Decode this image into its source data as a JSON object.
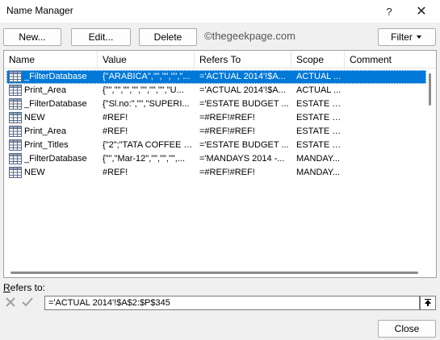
{
  "window": {
    "title": "Name Manager",
    "help": "?",
    "close": "✕"
  },
  "toolbar": {
    "new_label": "New...",
    "edit_label": "Edit...",
    "delete_label": "Delete",
    "filter_label": "Filter",
    "watermark": "©thegeekpage.com"
  },
  "columns": [
    "Name",
    "Value",
    "Refers To",
    "Scope",
    "Comment"
  ],
  "rows": [
    {
      "name": "_FilterDatabase",
      "value": "{\"ARABICA\",\"\",\"\",\"\",\"...",
      "refers_to": "='ACTUAL 2014'!$A...",
      "scope": "ACTUAL ...",
      "comment": "",
      "selected": true
    },
    {
      "name": "Print_Area",
      "value": "{\"\",\"\",\"\",\"\",\"\",\"\",\"\",\"U...",
      "refers_to": "='ACTUAL 2014'!$A...",
      "scope": "ACTUAL ...",
      "comment": "",
      "selected": false
    },
    {
      "name": "_FilterDatabase",
      "value": "{\"Sl.no:\",\"\",\"SUPERI...",
      "refers_to": "='ESTATE BUDGET ...",
      "scope": "ESTATE B...",
      "comment": "",
      "selected": false
    },
    {
      "name": "NEW",
      "value": "#REF!",
      "refers_to": "=#REF!#REF!",
      "scope": "ESTATE B...",
      "comment": "",
      "selected": false
    },
    {
      "name": "Print_Area",
      "value": "#REF!",
      "refers_to": "=#REF!#REF!",
      "scope": "ESTATE B...",
      "comment": "",
      "selected": false
    },
    {
      "name": "Print_Titles",
      "value": "{\"2\";\"TATA COFFEE L...",
      "refers_to": "='ESTATE BUDGET ...",
      "scope": "ESTATE B...",
      "comment": "",
      "selected": false
    },
    {
      "name": "_FilterDatabase",
      "value": "{\"\",\"Mar-12\",\"\",\"\",\"\",...",
      "refers_to": "='MANDAYS 2014 -...",
      "scope": "MANDAY...",
      "comment": "",
      "selected": false
    },
    {
      "name": "NEW",
      "value": "#REF!",
      "refers_to": "=#REF!#REF!",
      "scope": "MANDAY...",
      "comment": "",
      "selected": false
    }
  ],
  "refers_to": {
    "label_prefix": "R",
    "label_rest": "efers to:",
    "value": "='ACTUAL 2014'!$A$2:$P$345"
  },
  "footer": {
    "close_label": "Close"
  },
  "colors": {
    "selection": "#0078d7",
    "icon_green": "#217346"
  }
}
